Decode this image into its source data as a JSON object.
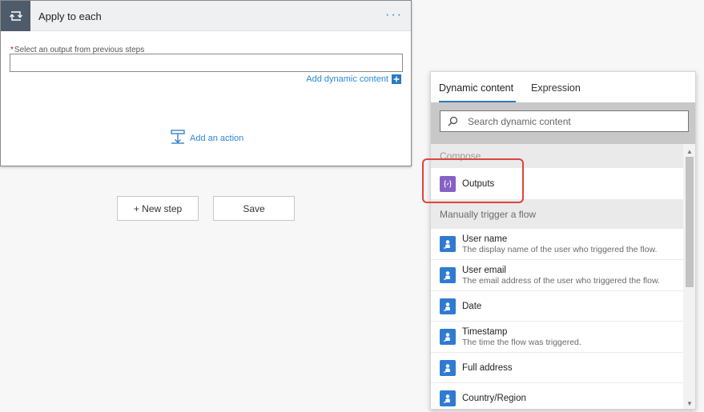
{
  "card": {
    "title": "Apply to each",
    "menu_label": "···",
    "field_label": "Select an output from previous steps",
    "field_required": "*",
    "field_value": "",
    "add_dynamic_label": "Add dynamic content",
    "add_action_label": "Add an action"
  },
  "buttons": {
    "new_step": "+ New step",
    "save": "Save"
  },
  "panel": {
    "tabs": [
      "Dynamic content",
      "Expression"
    ],
    "active_tab": "Dynamic content",
    "search_placeholder": "Search dynamic content",
    "sections": [
      {
        "title": "Compose",
        "items": [
          {
            "name": "Outputs",
            "desc": "",
            "icon": "compose-icon",
            "color": "#8661c5"
          }
        ]
      },
      {
        "title": "Manually trigger a flow",
        "items": [
          {
            "name": "User name",
            "desc": "The display name of the user who triggered the flow.",
            "icon": "user-icon",
            "color": "#2f7bd3"
          },
          {
            "name": "User email",
            "desc": "The email address of the user who triggered the flow.",
            "icon": "user-icon",
            "color": "#2f7bd3"
          },
          {
            "name": "Date",
            "desc": "",
            "icon": "user-icon",
            "color": "#2f7bd3"
          },
          {
            "name": "Timestamp",
            "desc": "The time the flow was triggered.",
            "icon": "user-icon",
            "color": "#2f7bd3"
          },
          {
            "name": "Full address",
            "desc": "",
            "icon": "user-icon",
            "color": "#2f7bd3"
          },
          {
            "name": "Country/Region",
            "desc": "",
            "icon": "user-icon",
            "color": "#2f7bd3"
          }
        ]
      }
    ]
  },
  "colors": {
    "accent": "#2b78c5",
    "link": "#2b88d8",
    "header_icon_bg": "#4e5b6b",
    "highlight": "#e0443f"
  }
}
